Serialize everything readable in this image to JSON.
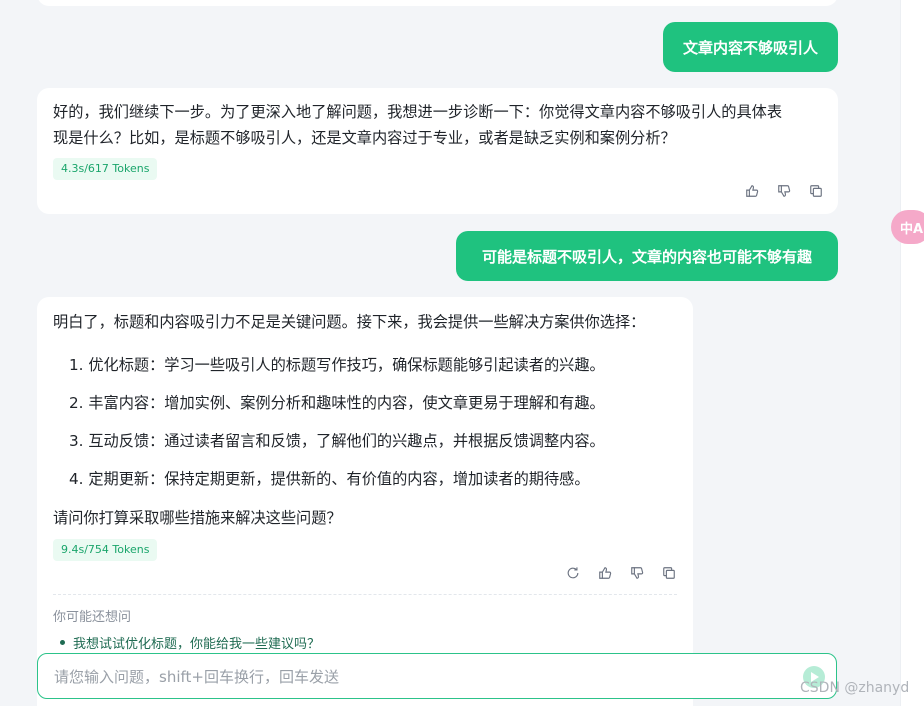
{
  "messages": {
    "user_1": "文章内容不够吸引人",
    "bot_1": {
      "line_1": "好的，我们继续下一步。为了更深入地了解问题，我想进一步诊断一下：你觉得文章内容不够吸引人的具体表",
      "line_2": "现是什么？比如，是标题不够吸引人，还是文章内容过于专业，或者是缺乏实例和案例分析？",
      "tokens": "4.3s/617 Tokens"
    },
    "user_2": "可能是标题不吸引人，文章的内容也可能不够有趣",
    "bot_2": {
      "intro": "明白了，标题和内容吸引力不足是关键问题。接下来，我会提供一些解决方案供你选择：",
      "list": [
        "1. 优化标题：学习一些吸引人的标题写作技巧，确保标题能够引起读者的兴趣。",
        "2. 丰富内容：增加实例、案例分析和趣味性的内容，使文章更易于理解和有趣。",
        "3. 互动反馈：通过读者留言和反馈，了解他们的兴趣点，并根据反馈调整内容。",
        "4. 定期更新：保持定期更新，提供新的、有价值的内容，增加读者的期待感。"
      ],
      "question": "请问你打算采取哪些措施来解决这些问题？",
      "tokens": "9.4s/754 Tokens"
    }
  },
  "suggestions": {
    "title": "你可能还想问",
    "items": [
      "我想试试优化标题，你能给我一些建议吗？"
    ]
  },
  "input": {
    "placeholder": "请您输入问题，shift+回车换行，回车发送",
    "value": ""
  },
  "translate_fab": {
    "label": "中A"
  },
  "watermark": "CSDN @zhanyd",
  "icons": {
    "like": "thumbs-up-icon",
    "dislike": "thumbs-down-icon",
    "copy": "copy-icon",
    "regenerate": "refresh-icon",
    "send": "send-icon"
  },
  "colors": {
    "accent": "#1fc27f",
    "token_bg": "#eafaf2",
    "token_text": "#1aa56b",
    "background": "#f3f5f8"
  }
}
